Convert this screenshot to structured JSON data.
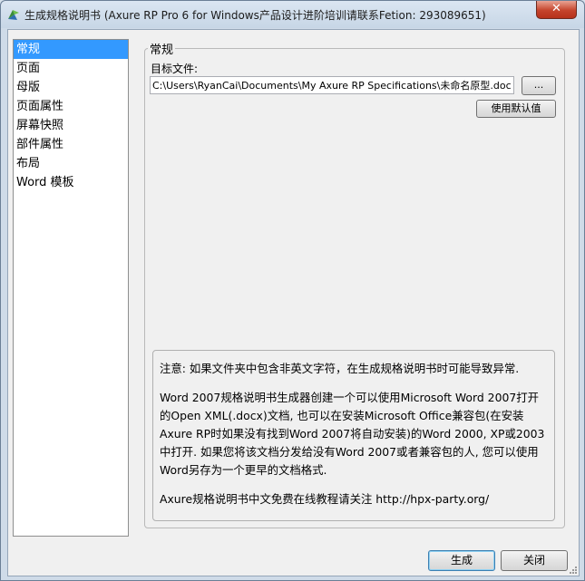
{
  "window": {
    "title": "生成规格说明书 (Axure RP Pro 6 for Windows产品设计进阶培训请联系Fetion: 293089651)",
    "close_label": "✕"
  },
  "sidebar": {
    "items": [
      {
        "label": "常规",
        "selected": true
      },
      {
        "label": "页面"
      },
      {
        "label": "母版"
      },
      {
        "label": "页面属性"
      },
      {
        "label": "屏幕快照"
      },
      {
        "label": "部件属性"
      },
      {
        "label": "布局"
      },
      {
        "label": "Word 模板"
      }
    ]
  },
  "general": {
    "group_title": "常规",
    "target_label": "目标文件:",
    "target_value": "C:\\Users\\RyanCai\\Documents\\My Axure RP Specifications\\未命名原型.docx",
    "browse_label": "...",
    "default_label": "使用默认值"
  },
  "note": {
    "para1": "注意: 如果文件夹中包含非英文字符，在生成规格说明书时可能导致异常.",
    "para2": "Word 2007规格说明书生成器创建一个可以使用Microsoft Word 2007打开的Open XML(.docx)文档, 也可以在安装Microsoft Office兼容包(在安装Axure RP时如果没有找到Word 2007将自动安装)的Word 2000, XP或2003中打开. 如果您将该文档分发给没有Word 2007或者兼容包的人, 您可以使用Word另存为一个更早的文档格式.",
    "para3": "Axure规格说明书中文免费在线教程请关注 http://hpx-party.org/"
  },
  "footer": {
    "generate_label": "生成",
    "close_label": "关闭"
  }
}
